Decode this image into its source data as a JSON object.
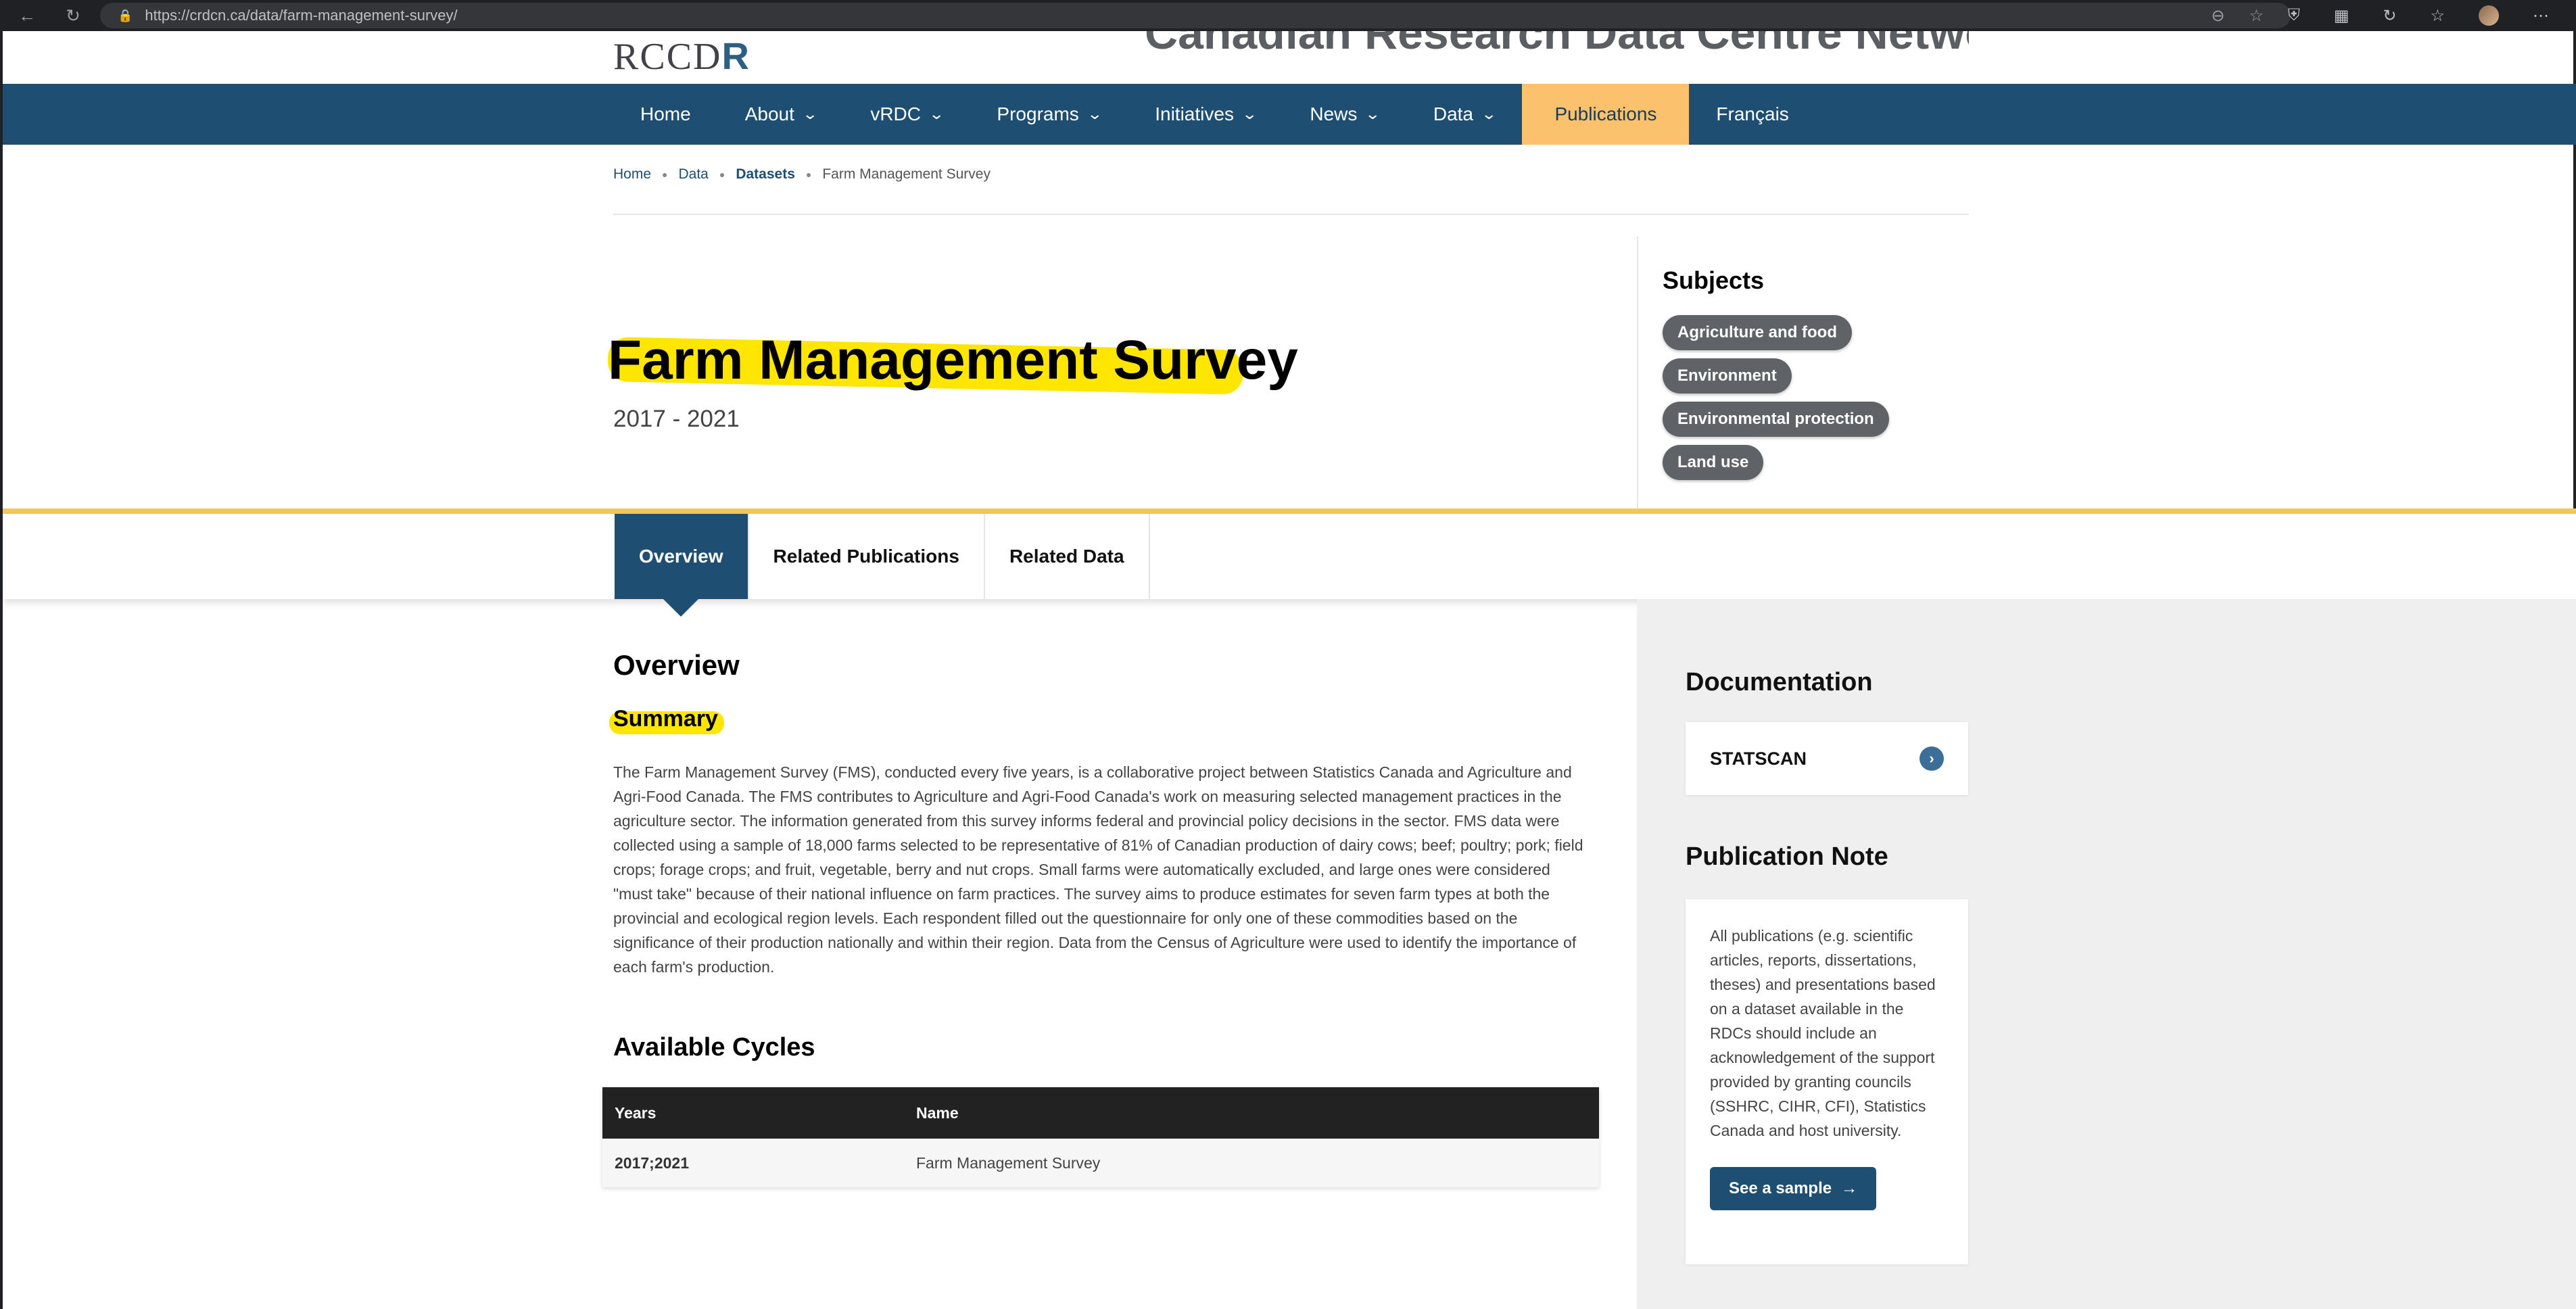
{
  "browser": {
    "url": "https://crdcn.ca/data/farm-management-survey/"
  },
  "site": {
    "logo_prefix": "RCCD",
    "logo_suffix": "R",
    "title": "Canadian Research Data Centre Network"
  },
  "nav": {
    "items": [
      {
        "label": "Home"
      },
      {
        "label": "About"
      },
      {
        "label": "vRDC"
      },
      {
        "label": "Programs"
      },
      {
        "label": "Initiatives"
      },
      {
        "label": "News"
      },
      {
        "label": "Data"
      },
      {
        "label": "Publications"
      },
      {
        "label": "Français"
      }
    ]
  },
  "breadcrumb": [
    "Home",
    "Data",
    "Datasets",
    "Farm Management Survey"
  ],
  "hero": {
    "title": "Farm Management Survey",
    "years": "2017 - 2021"
  },
  "subjects": {
    "title": "Subjects",
    "chips": [
      "Agriculture and food",
      "Environment",
      "Environmental protection",
      "Land use"
    ]
  },
  "tabs": [
    "Overview",
    "Related Publications",
    "Related Data"
  ],
  "main": {
    "overview_heading": "Overview",
    "summary_heading": "Summary",
    "summary_text": "The Farm Management Survey (FMS), conducted every five years, is a collaborative project between Statistics Canada and Agriculture and Agri-Food Canada. The FMS contributes to Agriculture and Agri-Food Canada's work on measuring selected management practices in the agriculture sector. The information generated from this survey informs federal and provincial policy decisions in the sector. FMS data were collected using a sample of 18,000 farms selected to be representative of 81% of Canadian production of dairy cows; beef; poultry; pork; field crops; forage crops; and fruit, vegetable, berry and nut crops. Small farms were automatically excluded, and large ones were considered \"must take\" because of their national influence on farm practices. The survey aims to produce estimates for seven farm types at both the provincial and ecological region levels. Each respondent filled out the questionnaire for only one of these commodities based on the significance of their production nationally and within their region. Data from the Census of Agriculture were used to identify the importance of each farm's production.",
    "cycles_heading": "Available Cycles",
    "table": {
      "headers": [
        "Years",
        "Name"
      ],
      "rows": [
        [
          "2017;2021",
          "Farm Management Survey"
        ]
      ]
    }
  },
  "sidebar": {
    "documentation_heading": "Documentation",
    "doc_link": "STATSCAN",
    "publication_note_heading": "Publication Note",
    "publication_note_text": "All publications (e.g. scientific articles, reports, dissertations, theses) and presentations based on a dataset available in the RDCs should include an acknowledgement of the support provided by granting councils (SSHRC, CIHR, CFI), Statistics Canada and host university.",
    "sample_button": "See a sample"
  }
}
